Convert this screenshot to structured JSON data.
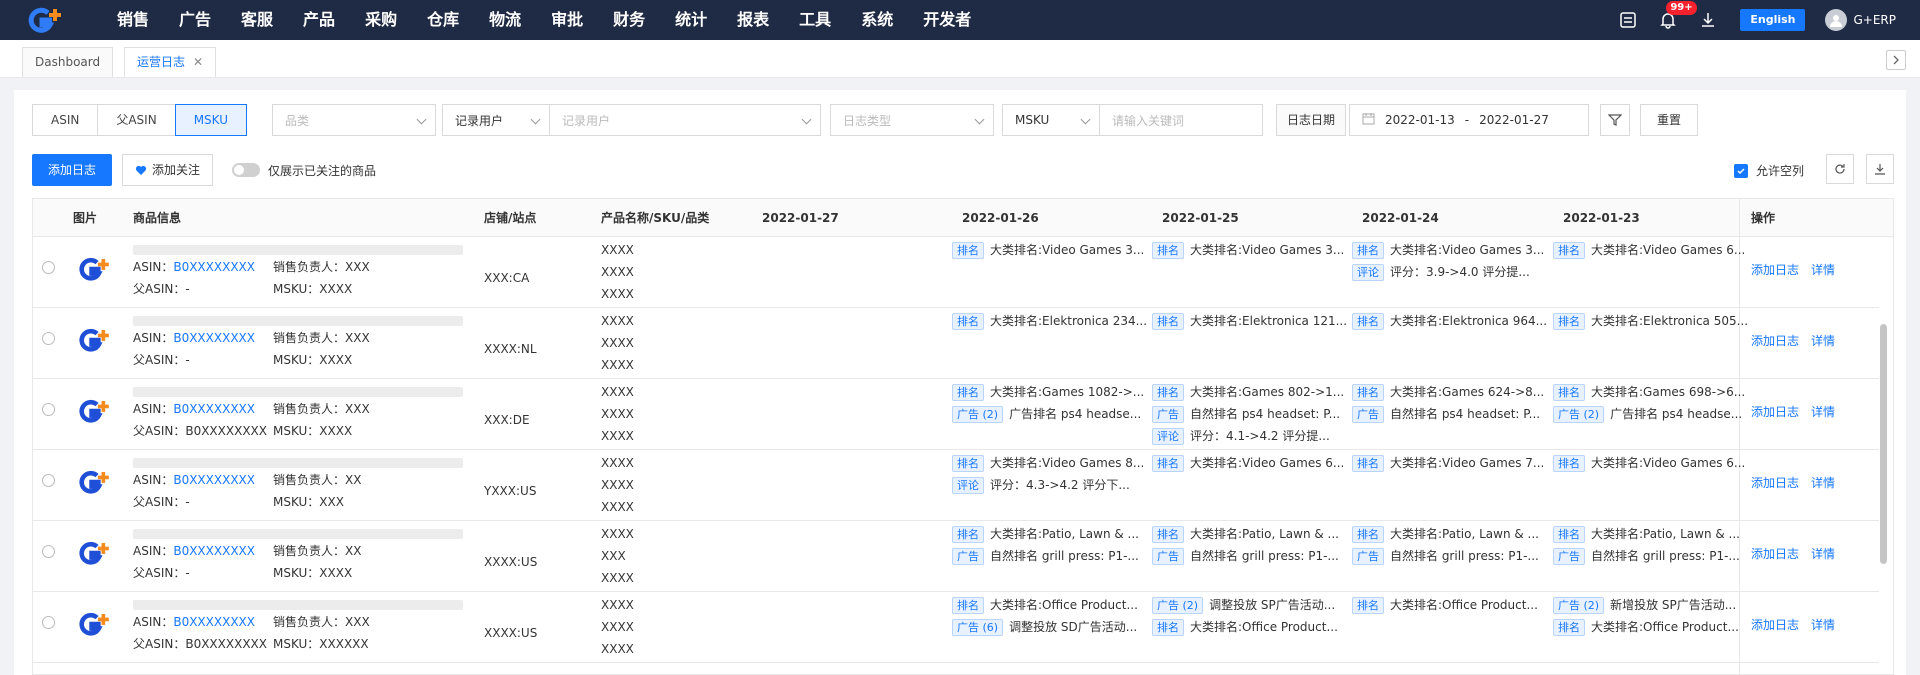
{
  "nav": {
    "items": [
      "销售",
      "广告",
      "客服",
      "产品",
      "采购",
      "仓库",
      "物流",
      "审批",
      "财务",
      "统计",
      "报表",
      "工具",
      "系统",
      "开发者"
    ],
    "badge": "99+",
    "lang": "English",
    "user": "G+ERP"
  },
  "tabs": [
    "Dashboard",
    "运营日志"
  ],
  "filters": {
    "segments": [
      "ASIN",
      "父ASIN",
      "MSKU"
    ],
    "category_placeholder": "品类",
    "recorder_select": "记录用户",
    "recorder_placeholder": "记录用户",
    "log_type_placeholder": "日志类型",
    "search_field": "MSKU",
    "search_placeholder": "请输入关键词",
    "date_label": "日志日期",
    "date_start": "2022-01-13",
    "date_sep": "-",
    "date_end": "2022-01-27",
    "reset": "重置"
  },
  "actions": {
    "add_log": "添加日志",
    "add_follow": "添加关注",
    "only_followed": "仅展示已关注的商品",
    "allow_empty": "允许空列"
  },
  "table": {
    "headers": {
      "image": "图片",
      "product": "商品信息",
      "store": "店铺/站点",
      "name": "产品名称/SKU/品类",
      "d1": "2022-01-27",
      "d2": "2022-01-26",
      "d3": "2022-01-25",
      "d4": "2022-01-24",
      "d5": "2022-01-23",
      "ops": "操作"
    },
    "rows": [
      {
        "asin_label": "ASIN：",
        "asin": "B0XXXXXXXX",
        "parent": "父ASIN：-",
        "owner": "销售负责人：XXX",
        "msku": "MSKU：XXXX",
        "store": "XXX:CA",
        "name": [
          "XXXX",
          "XXXX",
          "XXXX"
        ],
        "d2": [
          {
            "tag": "排名",
            "text": "大类排名:Video Games 3..."
          }
        ],
        "d3": [
          {
            "tag": "排名",
            "text": "大类排名:Video Games 3..."
          }
        ],
        "d4": [
          {
            "tag": "排名",
            "text": "大类排名:Video Games 3..."
          },
          {
            "tag": "评论",
            "text": "评分：3.9->4.0 评分提..."
          }
        ],
        "d5": [
          {
            "tag": "排名",
            "text": "大类排名:Video Games 6..."
          }
        ]
      },
      {
        "asin_label": "ASIN：",
        "asin": "B0XXXXXXXX",
        "parent": "父ASIN：-",
        "owner": "销售负责人：XXX",
        "msku": "MSKU：XXXX",
        "store": "XXXX:NL",
        "name": [
          "XXXX",
          "XXXX",
          "XXXX"
        ],
        "d2": [
          {
            "tag": "排名",
            "text": "大类排名:Elektronica 234..."
          }
        ],
        "d3": [
          {
            "tag": "排名",
            "text": "大类排名:Elektronica 121..."
          }
        ],
        "d4": [
          {
            "tag": "排名",
            "text": "大类排名:Elektronica 964..."
          }
        ],
        "d5": [
          {
            "tag": "排名",
            "text": "大类排名:Elektronica 505..."
          }
        ]
      },
      {
        "asin_label": "ASIN：",
        "asin": "B0XXXXXXXX",
        "parent": "父ASIN：B0XXXXXXXX",
        "owner": "销售负责人：XXX",
        "msku": "MSKU：XXXX",
        "store": "XXX:DE",
        "name": [
          "XXXX",
          "XXXX",
          "XXXX"
        ],
        "d2": [
          {
            "tag": "排名",
            "text": "大类排名:Games 1082->..."
          },
          {
            "tag": "广告 (2)",
            "text": "广告排名 ps4 headse..."
          }
        ],
        "d3": [
          {
            "tag": "排名",
            "text": "大类排名:Games 802->1..."
          },
          {
            "tag": "广告",
            "text": "自然排名 ps4 headset: P..."
          },
          {
            "tag": "评论",
            "text": "评分：4.1->4.2 评分提..."
          }
        ],
        "d4": [
          {
            "tag": "排名",
            "text": "大类排名:Games 624->8..."
          },
          {
            "tag": "广告",
            "text": "自然排名 ps4 headset: P..."
          }
        ],
        "d5": [
          {
            "tag": "排名",
            "text": "大类排名:Games 698->6..."
          },
          {
            "tag": "广告 (2)",
            "text": "广告排名 ps4 headse..."
          }
        ]
      },
      {
        "asin_label": "ASIN：",
        "asin": "B0XXXXXXXX",
        "parent": "父ASIN：-",
        "owner": "销售负责人：XX",
        "msku": "MSKU：XXX",
        "store": "YXXX:US",
        "name": [
          "XXXX",
          "XXXX",
          "XXXX"
        ],
        "d2": [
          {
            "tag": "排名",
            "text": "大类排名:Video Games 8..."
          },
          {
            "tag": "评论",
            "text": "评分：4.3->4.2 评分下..."
          }
        ],
        "d3": [
          {
            "tag": "排名",
            "text": "大类排名:Video Games 6..."
          }
        ],
        "d4": [
          {
            "tag": "排名",
            "text": "大类排名:Video Games 7..."
          }
        ],
        "d5": [
          {
            "tag": "排名",
            "text": "大类排名:Video Games 6..."
          }
        ]
      },
      {
        "asin_label": "ASIN：",
        "asin": "B0XXXXXXXX",
        "parent": "父ASIN：-",
        "owner": "销售负责人：XX",
        "msku": "MSKU：XXXX",
        "store": "XXXX:US",
        "name": [
          "XXXX",
          "XXX",
          "XXXX"
        ],
        "d2": [
          {
            "tag": "排名",
            "text": "大类排名:Patio, Lawn & ..."
          },
          {
            "tag": "广告",
            "text": "自然排名 grill press: P1-..."
          }
        ],
        "d3": [
          {
            "tag": "排名",
            "text": "大类排名:Patio, Lawn & ..."
          },
          {
            "tag": "广告",
            "text": "自然排名 grill press: P1-..."
          }
        ],
        "d4": [
          {
            "tag": "排名",
            "text": "大类排名:Patio, Lawn & ..."
          },
          {
            "tag": "广告",
            "text": "自然排名 grill press: P1-..."
          }
        ],
        "d5": [
          {
            "tag": "排名",
            "text": "大类排名:Patio, Lawn & ..."
          },
          {
            "tag": "广告",
            "text": "自然排名 grill press: P1-..."
          }
        ]
      },
      {
        "asin_label": "ASIN：",
        "asin": "B0XXXXXXXX",
        "parent": "父ASIN：B0XXXXXXXX",
        "owner": "销售负责人：XXX",
        "msku": "MSKU：XXXXXX",
        "store": "XXXX:US",
        "name": [
          "XXXX",
          "XXXX",
          "XXXX"
        ],
        "d2": [
          {
            "tag": "排名",
            "text": "大类排名:Office Product..."
          },
          {
            "tag": "广告 (6)",
            "text": "调整投放 SD广告活动..."
          }
        ],
        "d3": [
          {
            "tag": "广告 (2)",
            "text": "调整投放 SP广告活动..."
          },
          {
            "tag": "排名",
            "text": "大类排名:Office Product..."
          }
        ],
        "d4": [
          {
            "tag": "排名",
            "text": "大类排名:Office Product..."
          }
        ],
        "d5": [
          {
            "tag": "广告 (2)",
            "text": "新增投放 SP广告活动..."
          },
          {
            "tag": "排名",
            "text": "大类排名:Office Product..."
          }
        ]
      }
    ],
    "op_add": "添加日志",
    "op_detail": "详情"
  }
}
